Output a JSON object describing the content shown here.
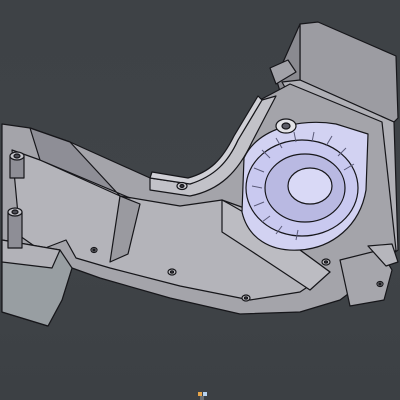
{
  "viewport": {
    "background": "#404448"
  },
  "model": {
    "name": "blower-fan-duct-housing",
    "body_color": "#a8a8ae",
    "highlight_color": "#c6c6cc",
    "shadow_color": "#7c7c84",
    "edge_color": "#16161a",
    "fan_color": "#c9c9f0",
    "fan_hub_color": "#b9b9e2"
  },
  "nav_cube": {
    "icon": "axis-triad-icon",
    "colors": [
      "#e8a64a",
      "#b7d2ef",
      "#6a6e72"
    ]
  }
}
